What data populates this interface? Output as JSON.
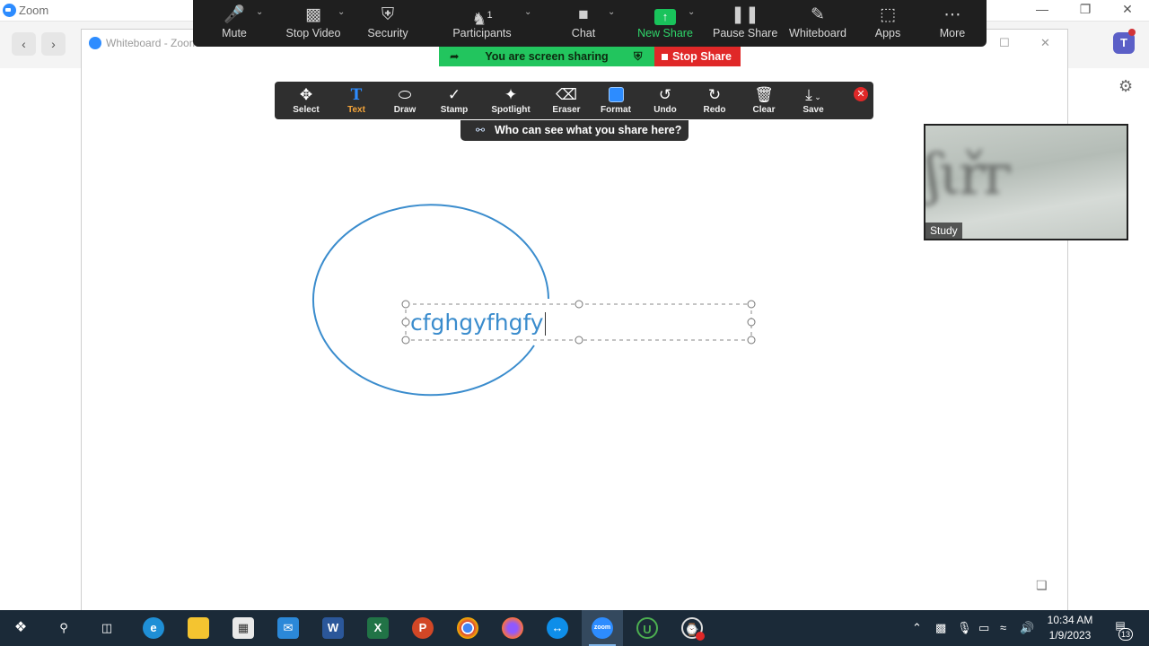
{
  "window": {
    "title": "Zoom",
    "inner_title": "Whiteboard - Zoom"
  },
  "meeting_toolbar": {
    "items": [
      {
        "label": "Mute",
        "icon": "microphone-icon"
      },
      {
        "label": "Stop Video",
        "icon": "video-camera-icon"
      },
      {
        "label": "Security",
        "icon": "shield-icon"
      },
      {
        "label": "Participants",
        "icon": "participants-icon",
        "count": "1"
      },
      {
        "label": "Chat",
        "icon": "chat-bubble-icon"
      },
      {
        "label": "New Share",
        "icon": "share-arrow-icon"
      },
      {
        "label": "Pause Share",
        "icon": "pause-icon"
      },
      {
        "label": "Whiteboard",
        "icon": "pencil-icon"
      },
      {
        "label": "Apps",
        "icon": "apps-icon"
      },
      {
        "label": "More",
        "icon": "more-dots-icon"
      }
    ]
  },
  "share_banner": {
    "text": "You are screen sharing",
    "stop_label": "Stop Share"
  },
  "annotation_toolbar": {
    "active": "Text",
    "items": [
      {
        "label": "Select",
        "icon": "move-icon"
      },
      {
        "label": "Text",
        "icon": "text-t-icon"
      },
      {
        "label": "Draw",
        "icon": "ellipse-icon"
      },
      {
        "label": "Stamp",
        "icon": "checkmark-icon"
      },
      {
        "label": "Spotlight",
        "icon": "magic-wand-icon"
      },
      {
        "label": "Eraser",
        "icon": "eraser-icon"
      },
      {
        "label": "Format",
        "icon": "format-square-icon"
      },
      {
        "label": "Undo",
        "icon": "undo-icon"
      },
      {
        "label": "Redo",
        "icon": "redo-icon"
      },
      {
        "label": "Clear",
        "icon": "trash-icon"
      },
      {
        "label": "Save",
        "icon": "save-download-icon"
      }
    ],
    "who_can_see": "Who can see what you share here?"
  },
  "canvas": {
    "typed_text": "cfghgyfhgfy",
    "stroke_color": "#3a8ccd"
  },
  "video": {
    "participant_name": "Study"
  },
  "taskbar": {
    "apps": [
      "windows-start-icon",
      "search-icon",
      "task-view-icon",
      "edge-icon",
      "file-explorer-icon",
      "store-icon",
      "mail-icon",
      "word-icon",
      "excel-icon",
      "powerpoint-icon",
      "chrome-icon",
      "firefox-icon",
      "teamviewer-icon",
      "zoom-icon",
      "utorrent-icon",
      "recorder-icon"
    ],
    "time": "10:34 AM",
    "date": "1/9/2023",
    "notification_count": "13"
  },
  "colors": {
    "accent": "#2d8cff",
    "share_green": "#22c55e",
    "stop_red": "#e02828",
    "toolbar_dark": "#1f1f1f",
    "annotation_dark": "#2f2f2f",
    "taskbar": "#1b2a38"
  }
}
